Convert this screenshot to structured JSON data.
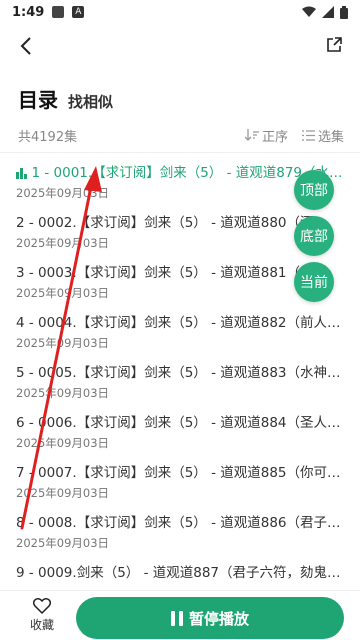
{
  "status": {
    "time": "1:49",
    "notif_letter": "A"
  },
  "header": {
    "title": "目录",
    "subtitle": "找相似"
  },
  "meta": {
    "count": "共4192集",
    "sort_label": "正序",
    "select_label": "选集"
  },
  "chapters": [
    {
      "title": "1 - 0001.【求订阅】剑来（5） - 道观道879（水…",
      "date": "2025年09月03日",
      "active": true
    },
    {
      "title": "2 - 0002.【求订阅】剑来（5） - 道观道880（酒…",
      "date": "2025年09月03日"
    },
    {
      "title": "3 - 0003.【求订阅】剑来（5） - 道观道881（世…",
      "date": "2025年09月03日"
    },
    {
      "title": "4 - 0004.【求订阅】剑来（5） - 道观道882（前人…",
      "date": "2025年09月03日"
    },
    {
      "title": "5 - 0005.【求订阅】剑来（5） - 道观道883（水神…",
      "date": "2025年09月03日"
    },
    {
      "title": "6 - 0006.【求订阅】剑来（5） - 道观道884（圣人…",
      "date": "2025年09月03日"
    },
    {
      "title": "7 - 0007.【求订阅】剑来（5） - 道观道885（你可…",
      "date": "2025年09月03日"
    },
    {
      "title": "8 - 0008.【求订阅】剑来（5） - 道观道886（君子…",
      "date": "2025年09月03日"
    },
    {
      "title": "9 - 0009.剑来（5） - 道观道887（君子六符，劾鬼…",
      "date": ""
    }
  ],
  "fabs": {
    "top": "顶部",
    "bottom": "底部",
    "current": "当前"
  },
  "bottom": {
    "fav_label": "收藏",
    "play_label": "暂停播放"
  },
  "colors": {
    "accent": "#1fa574",
    "annotation": "#e02020"
  }
}
